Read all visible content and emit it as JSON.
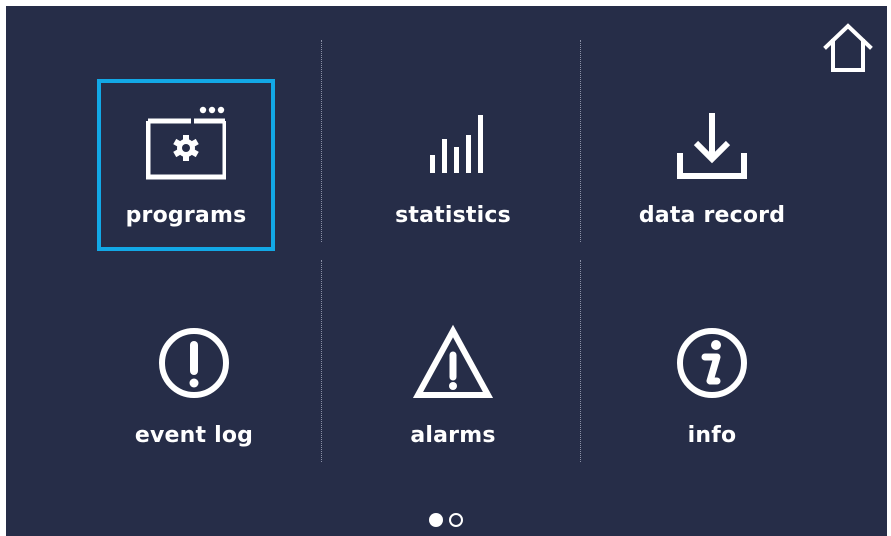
{
  "colors": {
    "background": "#262d48",
    "selection": "#12a8e6",
    "foreground": "#ffffff"
  },
  "header": {
    "home_icon": "home-icon"
  },
  "tiles": [
    {
      "label": "programs",
      "icon": "oven-program-icon",
      "selected": true
    },
    {
      "label": "statistics",
      "icon": "bar-chart-icon",
      "selected": false
    },
    {
      "label": "data record",
      "icon": "download-icon",
      "selected": false
    },
    {
      "label": "event log",
      "icon": "exclamation-circle-icon",
      "selected": false
    },
    {
      "label": "alarms",
      "icon": "warning-triangle-icon",
      "selected": false
    },
    {
      "label": "info",
      "icon": "info-circle-icon",
      "selected": false
    }
  ],
  "pager": {
    "pages": 2,
    "current": 1
  }
}
